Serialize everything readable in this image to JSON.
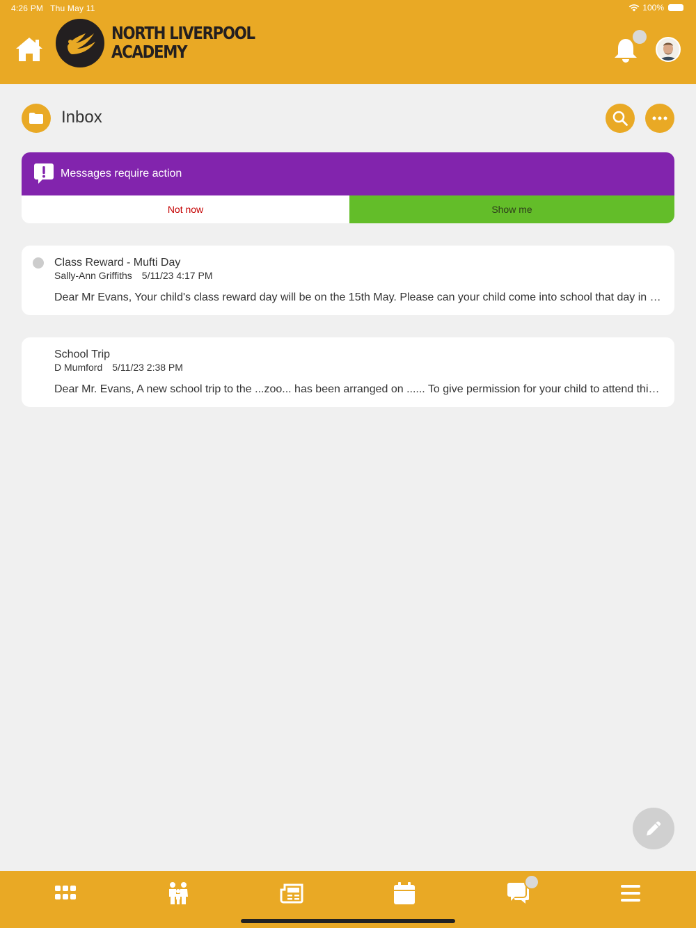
{
  "status_bar": {
    "time": "4:26 PM",
    "date": "Thu May 11",
    "battery": "100%"
  },
  "header": {
    "logo_line1": "NORTH LIVERPOOL",
    "logo_line2": "ACADEMY",
    "brand_color": "#e9a925",
    "icons": [
      "home-icon",
      "logo-icon",
      "bell-icon",
      "avatar"
    ]
  },
  "page": {
    "title": "Inbox"
  },
  "banner": {
    "message": "Messages require action",
    "not_now": "Not now",
    "show_me": "Show me",
    "banner_color": "#8224ad",
    "show_me_color": "#63bd29",
    "not_now_color": "#c40000"
  },
  "messages": [
    {
      "subject": "Class Reward - Mufti Day",
      "sender": "Sally-Ann Griffiths",
      "date": "5/11/23 4:17 PM",
      "preview": "Dear Mr Evans, Your child's class reward day will be on the 15th May. Please can your child come into school that day in Mufti clothes.",
      "unread": true
    },
    {
      "subject": "School Trip",
      "sender": "D Mumford",
      "date": "5/11/23 2:38 PM",
      "preview": "Dear Mr. Evans, A new school trip to the ...zoo... has been arranged on ...... To give permission for your child to attend this trip, please reply.",
      "unread": false
    }
  ],
  "bottom_nav": {
    "items": [
      "apps-icon",
      "family-icon",
      "news-icon",
      "calendar-icon",
      "messages-icon",
      "menu-icon"
    ]
  }
}
